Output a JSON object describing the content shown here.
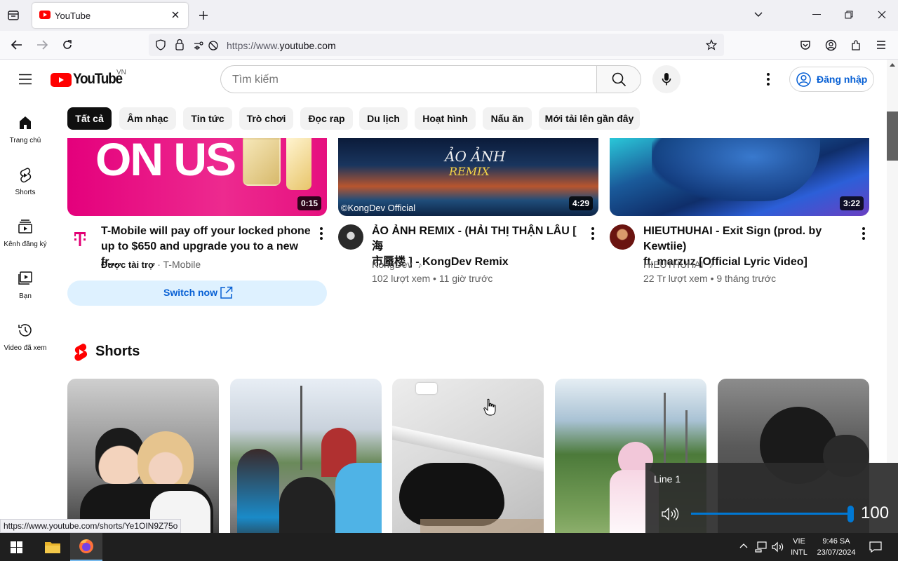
{
  "browser": {
    "tab_title": "YouTube",
    "url_prefix": "https://www.",
    "url_domain": "youtube.com",
    "status_url": "https://www.youtube.com/shorts/Ye1OIN9Z75o"
  },
  "header": {
    "logo_text": "YouTube",
    "region": "VN",
    "search_placeholder": "Tìm kiếm",
    "sign_in": "Đăng nhập"
  },
  "guide": [
    {
      "label": "Trang chủ",
      "icon": "home-icon"
    },
    {
      "label": "Shorts",
      "icon": "shorts-icon"
    },
    {
      "label": "Kênh đăng ký",
      "icon": "subscriptions-icon"
    },
    {
      "label": "Bạn",
      "icon": "you-icon"
    },
    {
      "label": "Video đã xem",
      "icon": "history-icon"
    }
  ],
  "chips": [
    "Tất cả",
    "Âm nhạc",
    "Tin tức",
    "Trò chơi",
    "Đọc rap",
    "Du lịch",
    "Hoạt hình",
    "Nấu ăn",
    "Mới tải lên gần đây"
  ],
  "videos": [
    {
      "thumb_text": "ON US",
      "duration": "0:15",
      "title_line1": "T-Mobile will pay off your locked phone",
      "title_line2": "up to $650 and upgrade you to a new fr...",
      "sponsored": "Được tài trợ",
      "channel": "T-Mobile",
      "cta": "Switch now"
    },
    {
      "thumb_text": "ẢO ẢNH",
      "thumb_sub": "REMIX",
      "watermark": "©KongDev Official",
      "duration": "4:29",
      "title_line1": "ẢO ẢNH REMIX - (HẢI THỊ THẬN LÂU [ 海",
      "title_line2": "市蜃楼 ] - KongDev Remix",
      "channel": "KongDev",
      "stats": "102 lượt xem • 11 giờ trước"
    },
    {
      "duration": "3:22",
      "title_line1": "HIEUTHUHAI - Exit Sign (prod. by Kewtiie)",
      "title_line2": "ft. marzuz [Official Lyric Video]",
      "channel": "HIEUTHUHAI",
      "stats": "22 Tr lượt xem • 9 tháng trước"
    }
  ],
  "shorts_heading": "Shorts",
  "volume": {
    "device": "Line 1",
    "level": 100
  },
  "taskbar": {
    "lang_top": "VIE",
    "lang_bottom": "INTL",
    "time": "9:46 SA",
    "date": "23/07/2024"
  },
  "colors": {
    "brand": "#ff0000",
    "tmobile": "#e20074",
    "link_blue": "#065fd4"
  }
}
